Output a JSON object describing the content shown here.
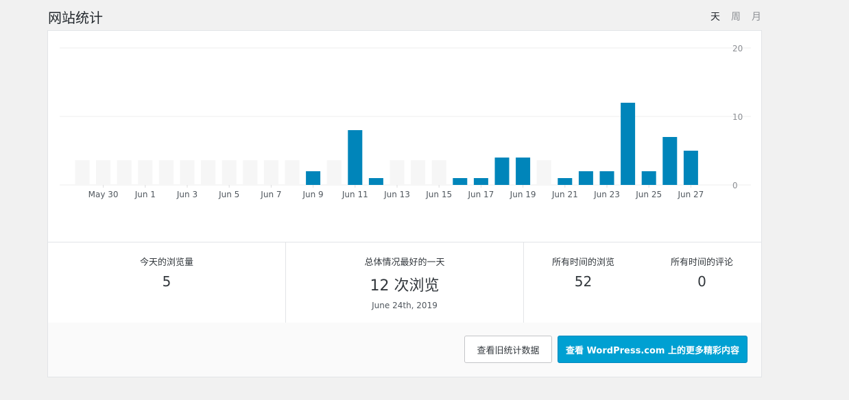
{
  "header": {
    "title": "网站统计"
  },
  "period_tabs": [
    {
      "label": "天",
      "active": true
    },
    {
      "label": "周",
      "active": false
    },
    {
      "label": "月",
      "active": false
    }
  ],
  "colors": {
    "bar": "#0085ba",
    "bar_empty": "#f6f6f6",
    "button_primary": "#00a0d2"
  },
  "chart_data": {
    "type": "bar",
    "categories": [
      "May 29",
      "May 30",
      "May 31",
      "Jun 1",
      "Jun 2",
      "Jun 3",
      "Jun 4",
      "Jun 5",
      "Jun 6",
      "Jun 7",
      "Jun 8",
      "Jun 9",
      "Jun 10",
      "Jun 11",
      "Jun 12",
      "Jun 13",
      "Jun 14",
      "Jun 15",
      "Jun 16",
      "Jun 17",
      "Jun 18",
      "Jun 19",
      "Jun 20",
      "Jun 21",
      "Jun 22",
      "Jun 23",
      "Jun 24",
      "Jun 25",
      "Jun 26",
      "Jun 27"
    ],
    "tick_labels": [
      "May 30",
      "Jun 1",
      "Jun 3",
      "Jun 5",
      "Jun 7",
      "Jun 9",
      "Jun 11",
      "Jun 13",
      "Jun 15",
      "Jun 17",
      "Jun 19",
      "Jun 21",
      "Jun 23",
      "Jun 25",
      "Jun 27"
    ],
    "values": [
      0,
      0,
      0,
      0,
      0,
      0,
      0,
      0,
      0,
      0,
      0,
      2,
      0,
      8,
      1,
      0,
      0,
      0,
      1,
      1,
      4,
      4,
      0,
      1,
      2,
      2,
      12,
      2,
      7,
      5
    ],
    "y_ticks": [
      0,
      10,
      20
    ],
    "ylim": [
      0,
      20
    ],
    "grid": true
  },
  "stats": {
    "today": {
      "label": "今天的浏览量",
      "value": "5"
    },
    "best_day": {
      "label": "总体情况最好的一天",
      "value": "12 次浏览",
      "date": "June 24th, 2019"
    },
    "all_time_views": {
      "label": "所有时间的浏览",
      "value": "52"
    },
    "all_time_comments": {
      "label": "所有时间的评论",
      "value": "0"
    }
  },
  "buttons": {
    "legacy": "查看旧统计数据",
    "more": "查看 WordPress.com 上的更多精彩内容"
  }
}
